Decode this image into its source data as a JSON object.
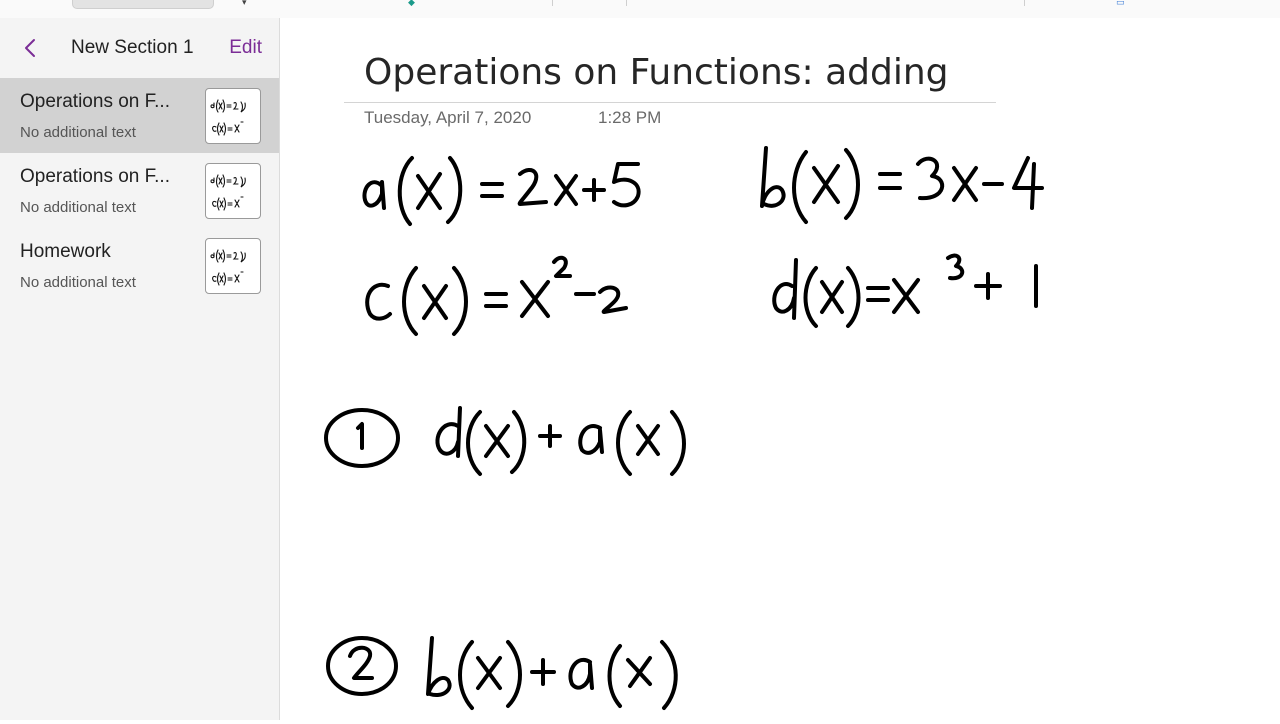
{
  "sidebar": {
    "section_title": "New Section 1",
    "edit_label": "Edit",
    "pages": [
      {
        "title": "Operations on F...",
        "subtitle": "No additional text",
        "selected": true
      },
      {
        "title": "Operations on F...",
        "subtitle": "No additional text",
        "selected": false
      },
      {
        "title": "Homework",
        "subtitle": "No additional text",
        "selected": false
      }
    ]
  },
  "page": {
    "title": "Operations on Functions: adding",
    "date": "Tuesday, April 7, 2020",
    "time": "1:28 PM"
  },
  "colors": {
    "accent": "#7b2d96",
    "sidebar_bg": "#f4f4f4",
    "selected_bg": "#d2d2d2",
    "ink": "#000000"
  },
  "icons": {
    "back": "chevron-left-icon"
  }
}
